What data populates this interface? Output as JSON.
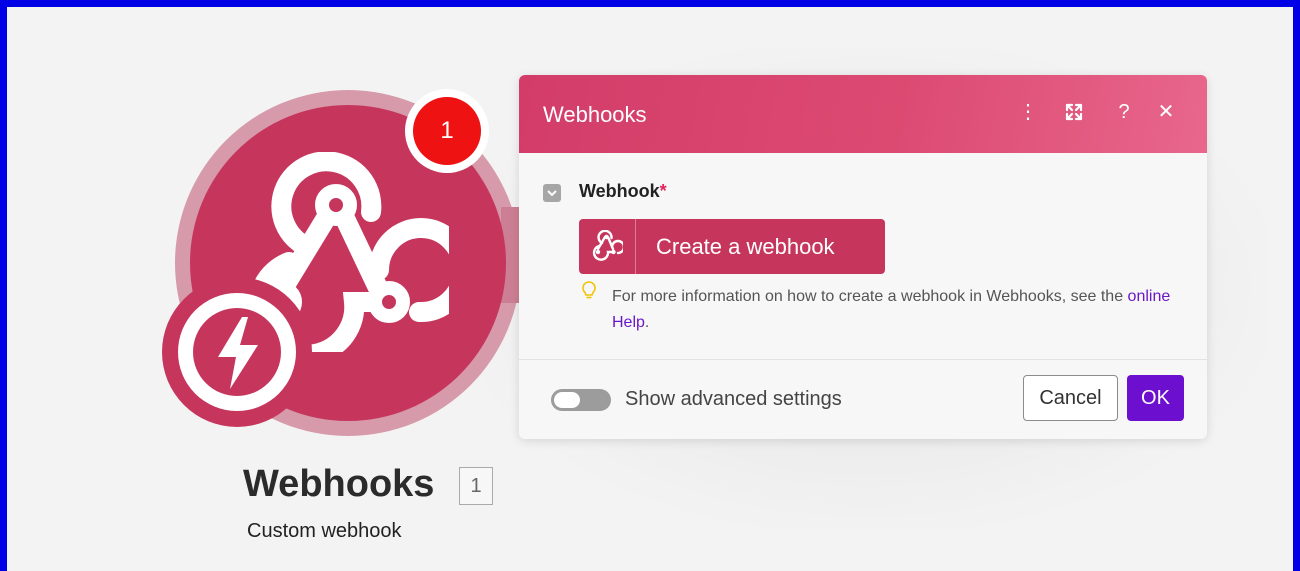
{
  "module": {
    "title": "Webhooks",
    "id": "1",
    "subtitle": "Custom webhook",
    "error_count": "1",
    "icon": "webhook-icon",
    "trigger_icon": "lightning-bolt-icon"
  },
  "dialog": {
    "title": "Webhooks",
    "header_actions": [
      {
        "icon": "more-vertical-icon",
        "glyph": "⋮"
      },
      {
        "icon": "expand-icon",
        "glyph": ""
      },
      {
        "icon": "help-icon",
        "glyph": "?"
      },
      {
        "icon": "close-icon",
        "glyph": "✕"
      }
    ],
    "field": {
      "label": "Webhook",
      "required_marker": "*"
    },
    "create_button": {
      "label": "Create a webhook",
      "icon": "webhook-icon"
    },
    "hint": {
      "icon": "lightbulb-icon",
      "text_before": "For more information on how to create a webhook in Webhooks, see the ",
      "link": "online Help",
      "text_after": "."
    },
    "advanced_toggle": {
      "label": "Show advanced settings",
      "checked": false
    },
    "cancel_label": "Cancel",
    "ok_label": "OK"
  },
  "colors": {
    "brand": "#c6365c",
    "header_start": "#d33c69",
    "header_end": "#e8668c",
    "primary_button": "#6d0fcf",
    "error_badge": "#ee1212",
    "frame_border": "#0000e6"
  }
}
